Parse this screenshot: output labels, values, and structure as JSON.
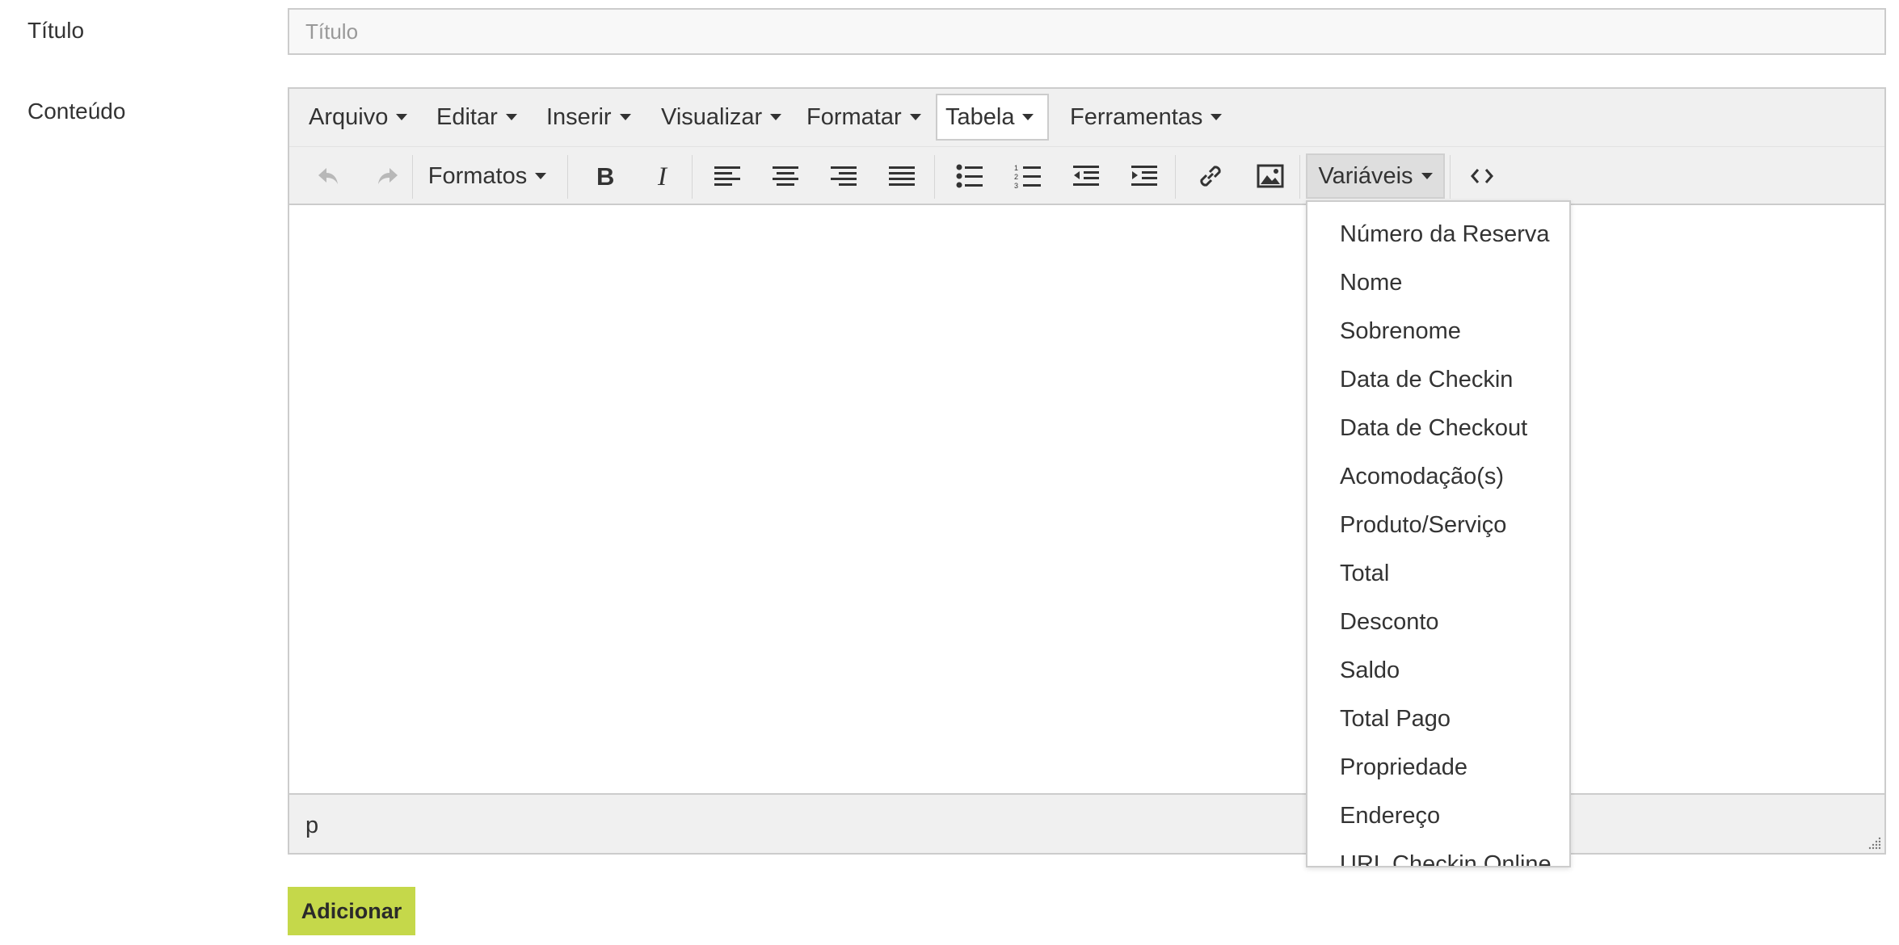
{
  "form": {
    "title_label": "Título",
    "title_placeholder": "Título",
    "title_value": "",
    "content_label": "Conteúdo",
    "submit_label": "Adicionar"
  },
  "editor": {
    "menubar": [
      {
        "label": "Arquivo"
      },
      {
        "label": "Editar"
      },
      {
        "label": "Inserir"
      },
      {
        "label": "Visualizar"
      },
      {
        "label": "Formatar"
      },
      {
        "label": "Tabela",
        "active": true
      },
      {
        "label": "Ferramentas"
      }
    ],
    "toolbar": {
      "undo_icon": "undo-icon",
      "redo_icon": "redo-icon",
      "formats_label": "Formatos",
      "bold_icon": "bold-icon",
      "italic_icon": "italic-icon",
      "align_icons": [
        "align-left-icon",
        "align-center-icon",
        "align-right-icon",
        "align-justify-icon"
      ],
      "list_icons": [
        "bullet-list-icon",
        "numbered-list-icon",
        "outdent-icon",
        "indent-icon"
      ],
      "link_icon": "link-icon",
      "image_icon": "image-icon",
      "variables_label": "Variáveis",
      "code_icon": "code-icon"
    },
    "statusbar_path": "p",
    "variables_menu": [
      "Número da Reserva",
      "Nome",
      "Sobrenome",
      "Data de Checkin",
      "Data de Checkout",
      "Acomodação(s)",
      "Produto/Serviço",
      "Total",
      "Desconto",
      "Saldo",
      "Total Pago",
      "Propriedade",
      "Endereço",
      "URL Checkin Online"
    ]
  },
  "colors": {
    "submit_button": "#c5d84a",
    "toolbar_bg": "#f0f0f0",
    "border": "#cccccc"
  }
}
